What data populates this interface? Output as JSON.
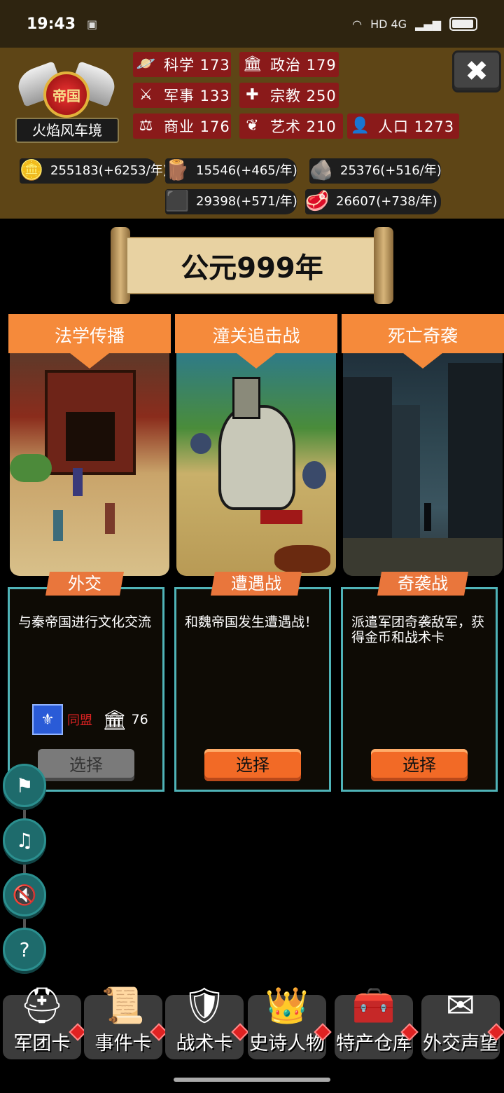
{
  "statusbar": {
    "time": "19:43",
    "network": "HD 4G",
    "wifi": "wifi-icon",
    "battery": "battery-icon"
  },
  "realm": {
    "emblem_text": "帝国",
    "name": "火焰风车境"
  },
  "stats": {
    "science": {
      "label": "科学 173"
    },
    "politics": {
      "label": "政治 179"
    },
    "military": {
      "label": "军事 133"
    },
    "religion": {
      "label": "宗教 250"
    },
    "commerce": {
      "label": "商业 176"
    },
    "art": {
      "label": "艺术 210"
    },
    "population": {
      "label": "人口 1273"
    }
  },
  "resources": {
    "gold": "255183(+6253/年)",
    "wood": "15546(+465/年)",
    "stone": "25376(+516/年)",
    "iron": "29398(+571/年)",
    "meat": "26607(+738/年)"
  },
  "year": "公元999年",
  "cards": [
    {
      "title": "法学传播",
      "type": "外交",
      "desc": "与秦帝国进行文化交流",
      "requirement": {
        "ally": "同盟",
        "value": "76"
      },
      "choose": "选择",
      "enabled": false
    },
    {
      "title": "潼关追击战",
      "type": "遭遇战",
      "desc": "和魏帝国发生遭遇战！",
      "choose": "选择",
      "enabled": true
    },
    {
      "title": "死亡奇袭",
      "type": "奇袭战",
      "desc": "派遣军团奇袭敌军，获得金币和战术卡",
      "choose": "选择",
      "enabled": true
    }
  ],
  "side_buttons": [
    "flag-icon",
    "music-off-icon",
    "sound-off-icon",
    "help-icon"
  ],
  "nav": [
    {
      "label": "军团卡"
    },
    {
      "label": "事件卡"
    },
    {
      "label": "战术卡"
    },
    {
      "label": "史诗人物"
    },
    {
      "label": "特产仓库"
    },
    {
      "label": "外交声望"
    }
  ],
  "colors": {
    "header_bg": "#5e4516",
    "stat_bg": "#8a1a1a",
    "banner": "#f58a3b",
    "panel_border": "#4fb3b8",
    "choose_active": "#f26a26"
  }
}
